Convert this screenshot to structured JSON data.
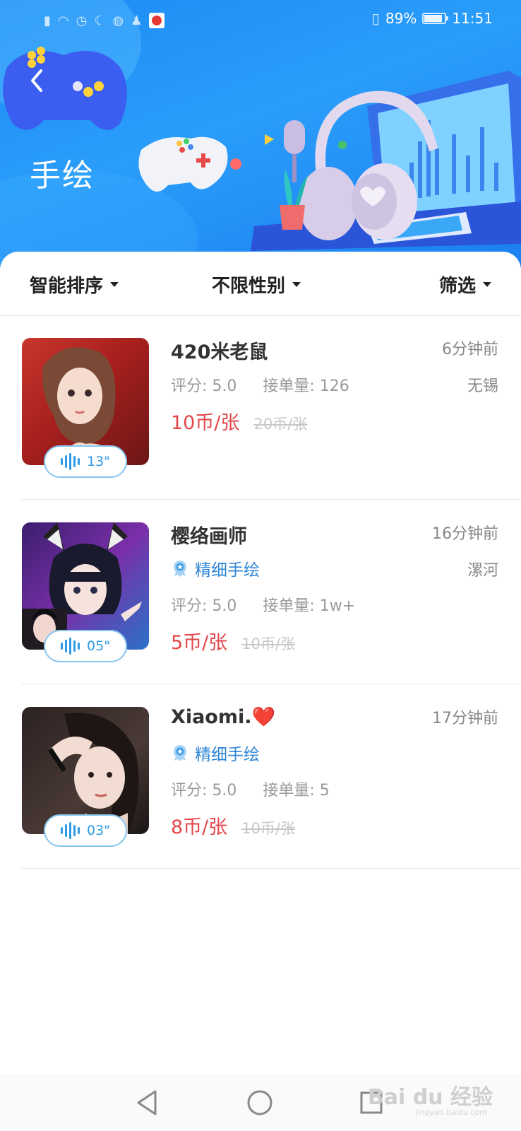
{
  "status_bar": {
    "battery": "89%",
    "battery_level": 0.89,
    "time": "11:51",
    "left_icons": [
      "signal-icon",
      "wifi-icon",
      "alarm-icon",
      "moon-icon",
      "globe-icon",
      "qq-icon",
      "news-app-icon"
    ],
    "right_icons": [
      "vibrate-icon",
      "battery-icon"
    ]
  },
  "header": {
    "back_icon": "chevron-left-icon",
    "title": "手绘"
  },
  "filters": {
    "sort": "智能排序",
    "gender": "不限性别",
    "screen": "筛选"
  },
  "listings": [
    {
      "name": "420米老鼠",
      "time": "6分钟前",
      "city": "无锡",
      "badge": "",
      "rating_label": "评分: 5.0",
      "orders_label": "接单量: 126",
      "price": "10币/张",
      "orig_price": "20币/张",
      "voice_len": "13\""
    },
    {
      "name": "樱络画师",
      "time": "16分钟前",
      "city": "漯河",
      "badge": "精细手绘",
      "rating_label": "评分: 5.0",
      "orders_label": "接单量: 1w+",
      "price": "5币/张",
      "orig_price": "10币/张",
      "voice_len": "05\""
    },
    {
      "name": "Xiaomi.❤️",
      "time": "17分钟前",
      "city": "",
      "badge": "精细手绘",
      "rating_label": "评分: 5.0",
      "orders_label": "接单量: 5",
      "price": "8币/张",
      "orig_price": "10币/张",
      "voice_len": "03\""
    }
  ],
  "nav_bar": {
    "buttons": [
      "back-triangle-icon",
      "home-circle-icon",
      "recents-square-icon"
    ]
  },
  "watermark": {
    "text": "Bai du 经验",
    "sub": "jingyan.baidu.com"
  },
  "colors": {
    "header_blue": "#1e8bf5",
    "price_red": "#e2474a",
    "badge_blue": "#2f86d6",
    "voice_blue": "#2f9be6"
  }
}
